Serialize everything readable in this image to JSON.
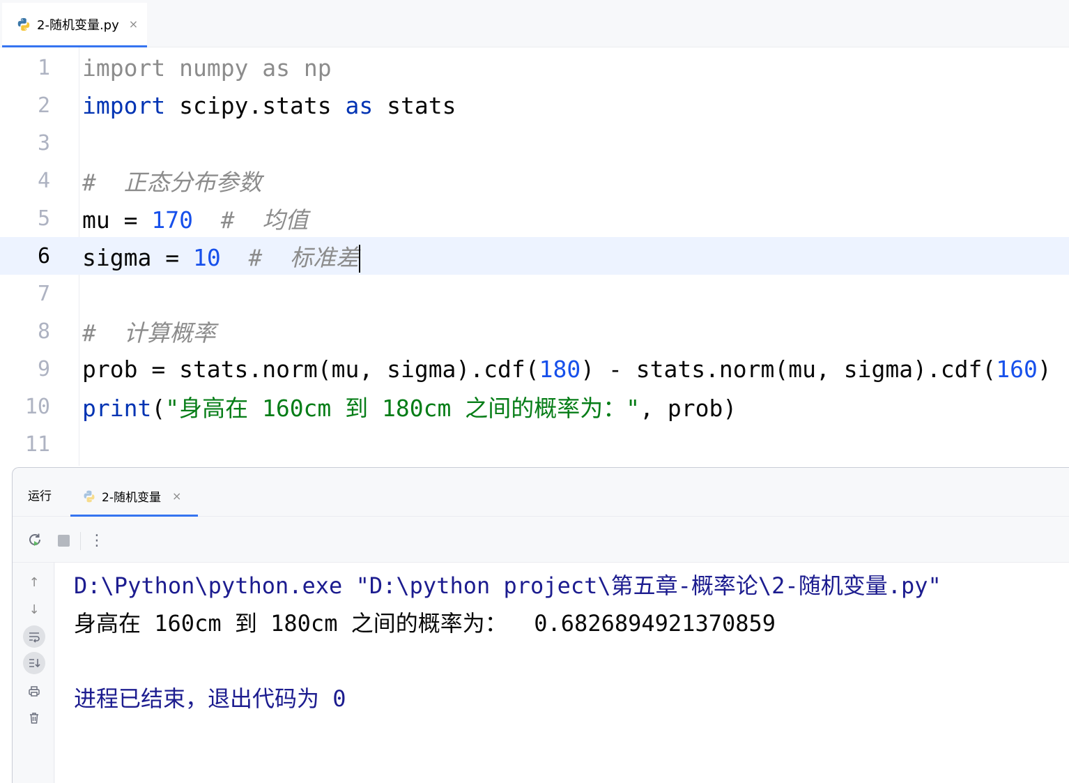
{
  "editor_tab": {
    "filename": "2-随机变量.py",
    "close": "×",
    "icon": "python-file-icon"
  },
  "code_lines": [
    {
      "n": "1",
      "parts": [
        {
          "t": "import",
          "c": "kw-dim"
        },
        {
          "t": " numpy ",
          "c": "kw-dim"
        },
        {
          "t": "as",
          "c": "kw-dim"
        },
        {
          "t": " np",
          "c": "kw-dim"
        }
      ]
    },
    {
      "n": "2",
      "parts": [
        {
          "t": "import",
          "c": "kw"
        },
        {
          "t": " scipy.stats ",
          "c": ""
        },
        {
          "t": "as",
          "c": "kw"
        },
        {
          "t": " stats",
          "c": ""
        }
      ]
    },
    {
      "n": "3",
      "parts": []
    },
    {
      "n": "4",
      "parts": [
        {
          "t": "#  正态分布参数",
          "c": "cmt"
        }
      ]
    },
    {
      "n": "5",
      "parts": [
        {
          "t": "mu = ",
          "c": ""
        },
        {
          "t": "170",
          "c": "num"
        },
        {
          "t": "  ",
          "c": ""
        },
        {
          "t": "#  均值",
          "c": "cmt"
        }
      ]
    },
    {
      "n": "6",
      "parts": [
        {
          "t": "sigma = ",
          "c": ""
        },
        {
          "t": "10",
          "c": "num"
        },
        {
          "t": "  ",
          "c": ""
        },
        {
          "t": "#  标准差",
          "c": "cmt"
        }
      ],
      "current": true
    },
    {
      "n": "7",
      "parts": []
    },
    {
      "n": "8",
      "parts": [
        {
          "t": "#  计算概率",
          "c": "cmt"
        }
      ]
    },
    {
      "n": "9",
      "parts": [
        {
          "t": "prob = stats.norm(mu, sigma).cdf(",
          "c": ""
        },
        {
          "t": "180",
          "c": "num"
        },
        {
          "t": ") - stats.norm(mu, sigma).cdf(",
          "c": ""
        },
        {
          "t": "160",
          "c": "num"
        },
        {
          "t": ")",
          "c": ""
        }
      ]
    },
    {
      "n": "10",
      "parts": [
        {
          "t": "print",
          "c": "kw"
        },
        {
          "t": "(",
          "c": ""
        },
        {
          "t": "\"身高在 160cm 到 180cm 之间的概率为：\"",
          "c": "str"
        },
        {
          "t": ", prob)",
          "c": ""
        }
      ]
    },
    {
      "n": "11",
      "parts": []
    }
  ],
  "run_panel": {
    "title": "运行",
    "tab_label": "2-随机变量",
    "tab_close": "×",
    "toolbar": {
      "rerun_icon": "rerun-icon",
      "stop_icon": "stop-icon",
      "more": "⋮"
    },
    "side_icons": [
      "arrow-up-icon",
      "arrow-down-icon",
      "soft-wrap-icon",
      "scroll-to-end-icon",
      "print-icon",
      "trash-icon"
    ],
    "console": {
      "command": "D:\\Python\\python.exe \"D:\\python project\\第五章-概率论\\2-随机变量.py\"",
      "output": "身高在 160cm 到 180cm 之间的概率为：  0.6826894921370859",
      "exit": "进程已结束，退出代码为 0"
    }
  }
}
